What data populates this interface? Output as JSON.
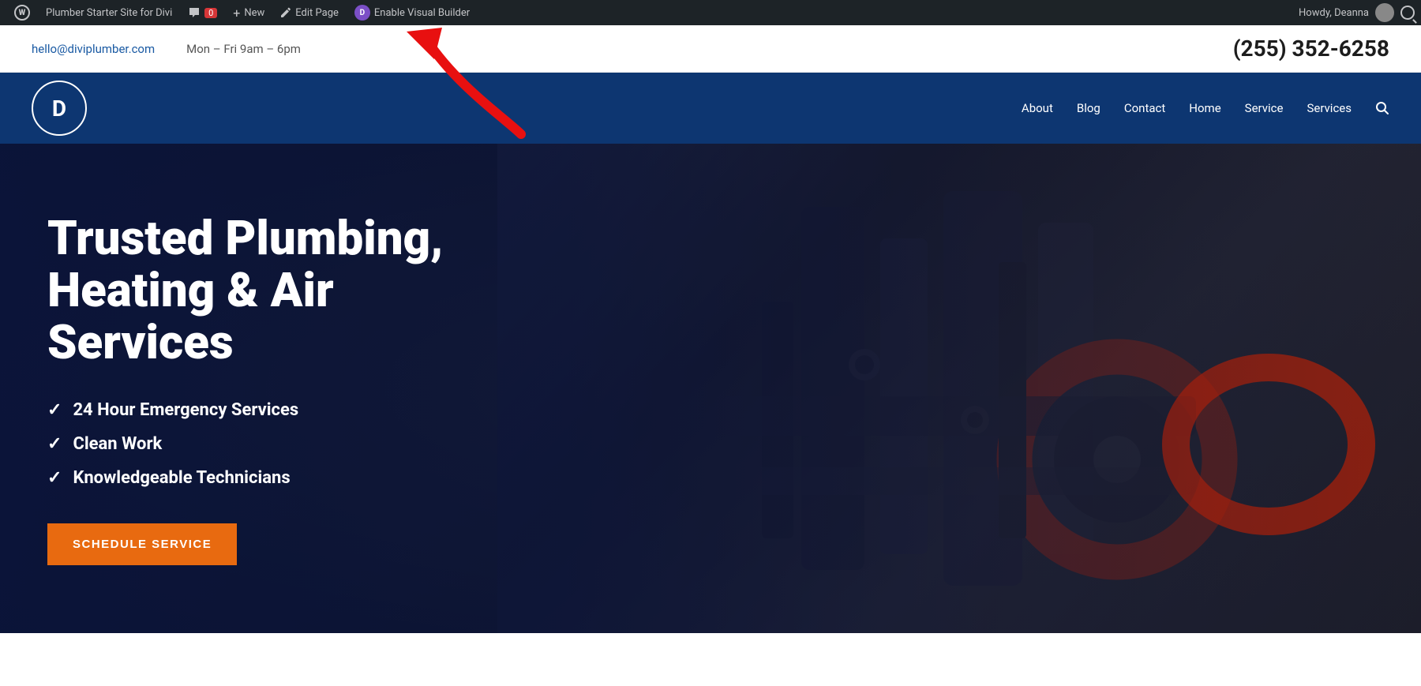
{
  "admin_bar": {
    "site_title": "Plumber Starter Site for Divi",
    "comments_label": "Comments",
    "comments_count": "0",
    "new_label": "New",
    "edit_page_label": "Edit Page",
    "visual_builder_label": "Enable Visual Builder",
    "howdy_label": "Howdy, Deanna",
    "wp_icon": "W",
    "divi_icon": "D"
  },
  "top_bar": {
    "email": "hello@diviplumber.com",
    "hours": "Mon – Fri 9am – 6pm",
    "phone": "(255) 352-6258"
  },
  "navigation": {
    "logo_letter": "D",
    "items": [
      {
        "label": "About"
      },
      {
        "label": "Blog"
      },
      {
        "label": "Contact"
      },
      {
        "label": "Home"
      },
      {
        "label": "Service"
      },
      {
        "label": "Services"
      }
    ]
  },
  "hero": {
    "title": "Trusted Plumbing, Heating & Air Services",
    "features": [
      "24 Hour Emergency Services",
      "Clean Work",
      "Knowledgeable Technicians"
    ],
    "cta_label": "SCHEDULE SERVICE"
  }
}
